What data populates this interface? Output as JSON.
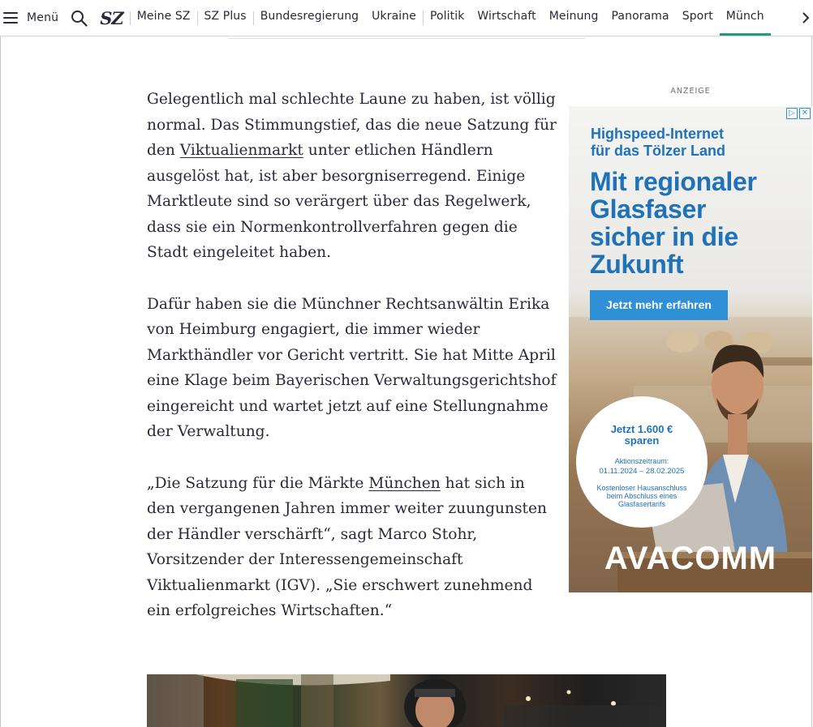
{
  "header": {
    "menu_label": "Menü",
    "logo": "SZ",
    "nav": [
      {
        "label": "Meine SZ"
      },
      {
        "label": "SZ Plus"
      },
      {
        "label": "Bundesregierung"
      },
      {
        "label": "Ukraine"
      },
      {
        "label": "Politik"
      },
      {
        "label": "Wirtschaft"
      },
      {
        "label": "Meinung"
      },
      {
        "label": "Panorama"
      },
      {
        "label": "Sport"
      },
      {
        "label": "Münch"
      }
    ]
  },
  "article": {
    "p1": {
      "before": "Gelegentlich mal schlechte Laune zu haben, ist völlig normal. Das Stimmungstief, das die neue Satzung für den ",
      "link": "Viktualienmarkt",
      "after": " unter etlichen Händlern ausgelöst hat, ist aber besorgniserregend. Einige Marktleute sind so verärgert über das Regelwerk, dass sie ein Normenkontrollverfahren gegen die Stadt eingeleitet haben."
    },
    "p2": "Dafür haben sie die Münchner Rechtsanwältin Erika von Heimburg engagiert, die immer wieder Markthändler vor Gericht vertritt. Sie hat Mitte April eine Klage beim Bayerischen Verwaltungsgerichtshof eingereicht und wartet jetzt auf eine Stellungnahme der Verwaltung.",
    "p3": {
      "before": "„Die Satzung für die Märkte ",
      "link": "München",
      "after": " hat sich in den vergangenen Jahren immer weiter zuungunsten der Händler verschärft“, sagt Marco Stohr, Vorsitzender der Interessengemeinschaft Viktualienmarkt (IGV). „Sie erschwert zunehmend ein erfolgreiches Wirtschaften.“"
    }
  },
  "ad": {
    "label": "ANZEIGE",
    "head_line1": "Highspeed-Internet",
    "head_line2": "für das Tölzer Land",
    "headline": [
      "Mit regionaler",
      "Glasfaser",
      "sicher in die",
      "Zukunft"
    ],
    "cta": "Jetzt mehr erfahren",
    "circle": {
      "save_line1": "Jetzt 1.600 €",
      "save_line2": "sparen",
      "period_label": "Aktionszeitraum:",
      "period": "01.11.2024 – 28.02.2025",
      "note_line1": "Kostenloser Hausanschluss",
      "note_line2": "beim Abschluss eines",
      "note_line3": "Glasfasertarifs"
    },
    "brand": "AVACOMM"
  },
  "colors": {
    "text": "#29293a",
    "active_tab": "#1f9b85",
    "ad_blue": "#1f72b8",
    "ad_button": "#2f8fd7"
  }
}
